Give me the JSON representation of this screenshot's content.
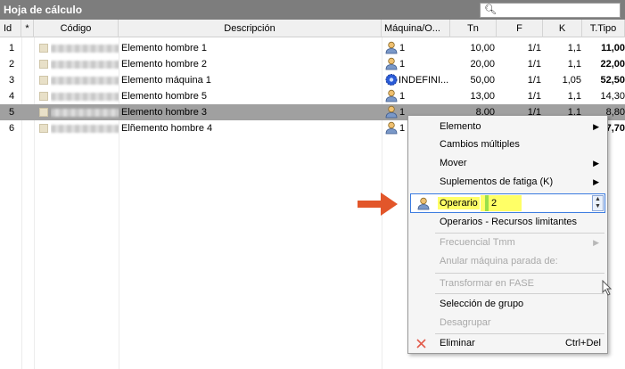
{
  "window": {
    "title": "Hoja de cálculo"
  },
  "search": {
    "value": ""
  },
  "columns": {
    "id": "Id",
    "star": "*",
    "code": "Código",
    "desc": "Descripción",
    "machine": "Máquina/O...",
    "tn": "Tn",
    "f": "F",
    "k": "K",
    "ttipo": "T.Tipo"
  },
  "rows": [
    {
      "id": "1",
      "desc": "Elemento hombre 1",
      "machine": "1",
      "machine_icon": "user-icon",
      "tn": "10,00",
      "f": "1/1",
      "k": "1,1",
      "ttipo": "11,00"
    },
    {
      "id": "2",
      "desc": "Elemento hombre 2",
      "machine": "1",
      "machine_icon": "user-icon",
      "tn": "20,00",
      "f": "1/1",
      "k": "1,1",
      "ttipo": "22,00"
    },
    {
      "id": "3",
      "desc": "Elemento máquina 1",
      "machine": "INDEFINI...",
      "machine_icon": "gear-icon",
      "tn": "50,00",
      "f": "1/1",
      "k": "1,05",
      "ttipo": "52,50"
    },
    {
      "id": "4",
      "desc": "Elemento hombre 5",
      "machine": "1",
      "machine_icon": "user-icon",
      "tn": "13,00",
      "f": "1/1",
      "k": "1,1",
      "ttipo": "14,30"
    },
    {
      "id": "5",
      "desc": "Elemento hombre 3",
      "machine": "1",
      "machine_icon": "user-icon",
      "tn": "8,00",
      "f": "1/1",
      "k": "1,1",
      "ttipo": "8,80"
    },
    {
      "id": "6",
      "desc": "Elñemento hombre 4",
      "machine": "1",
      "machine_icon": "user-icon",
      "tn": "",
      "f": "",
      "k": "",
      "ttipo": "7,70"
    }
  ],
  "menu": {
    "elemento": "Elemento",
    "cambios": "Cambios múltiples",
    "mover": "Mover",
    "suplementos": "Suplementos de fatiga (K)",
    "operario_label": "Operario",
    "operario_value": "2",
    "operarios_recursos": "Operarios - Recursos limitantes",
    "frecuencial": "Frecuencial Tmm",
    "anular": "Anular máquina parada de:",
    "transformar": "Transformar en FASE",
    "seleccion": "Selección de grupo",
    "desagrupar": "Desagrupar",
    "eliminar": "Eliminar",
    "eliminar_shortcut": "Ctrl+Del"
  },
  "colors": {
    "selected_row": "#a0a0a0",
    "titlebar": "#7d7d7d",
    "highlight": "#ffff66",
    "arrow": "#e2562a"
  }
}
